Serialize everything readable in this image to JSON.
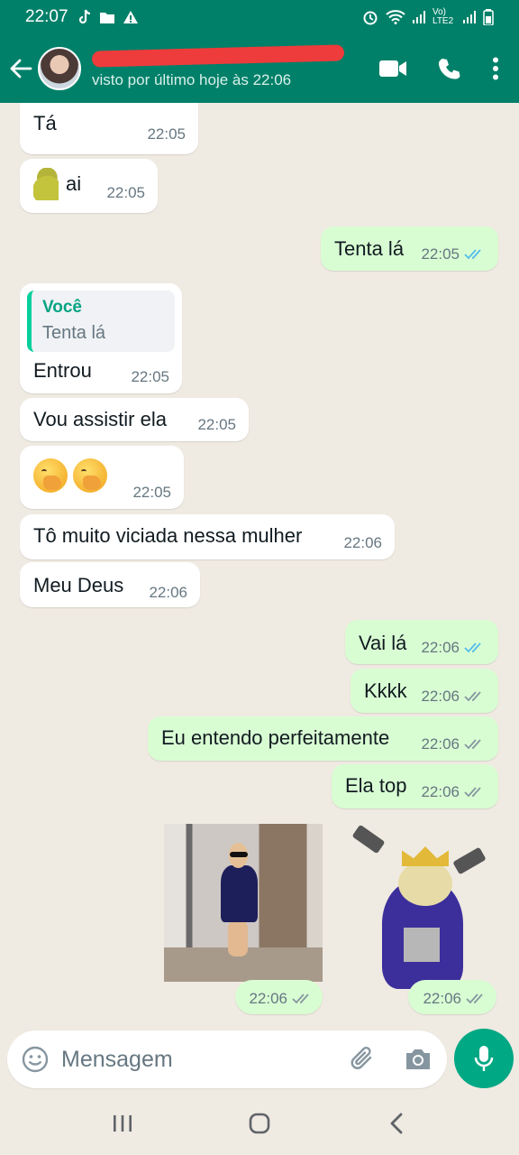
{
  "status_bar": {
    "time": "22:07",
    "network": "Vo) LTE2"
  },
  "header": {
    "contact_status": "visto por último hoje às 22:06"
  },
  "messages": [
    {
      "dir": "in",
      "text": "Tá",
      "time": "22:05"
    },
    {
      "dir": "in",
      "text": "ai",
      "time": "22:05",
      "emoji": "pear"
    },
    {
      "dir": "out",
      "text": "Tenta lá",
      "time": "22:05",
      "ticks": "read"
    },
    {
      "dir": "in",
      "text": "Entrou",
      "time": "22:05",
      "quote_author": "Você",
      "quote_text": "Tenta lá"
    },
    {
      "dir": "in",
      "text": "Vou assistir ela",
      "time": "22:05"
    },
    {
      "dir": "in",
      "text": "",
      "time": "22:05",
      "emoji": "hand-over-mouth x2"
    },
    {
      "dir": "in",
      "text": "Tô muito viciada nessa mulher",
      "time": "22:06"
    },
    {
      "dir": "in",
      "text": "Meu Deus",
      "time": "22:06"
    },
    {
      "dir": "out",
      "text": "Vai lá",
      "time": "22:06",
      "ticks": "read"
    },
    {
      "dir": "out",
      "text": "Kkkk",
      "time": "22:06",
      "ticks": "delivered"
    },
    {
      "dir": "out",
      "text": "Eu entendo perfeitamente",
      "time": "22:06",
      "ticks": "delivered"
    },
    {
      "dir": "out",
      "text": "Ela top",
      "time": "22:06",
      "ticks": "delivered"
    },
    {
      "dir": "out",
      "type": "gif",
      "time": "22:06",
      "ticks": "delivered"
    },
    {
      "dir": "out",
      "type": "sticker",
      "time": "22:06",
      "ticks": "delivered"
    }
  ],
  "composer": {
    "placeholder": "Mensagem"
  },
  "colors": {
    "header": "#008069",
    "outgoing": "#d9fdd3",
    "incoming": "#ffffff",
    "accent": "#00a884",
    "read_tick": "#53bdeb",
    "background": "#efeae2"
  },
  "icons": [
    "back-arrow-icon",
    "video-call-icon",
    "phone-icon",
    "more-options-icon",
    "emoji-icon",
    "attach-icon",
    "camera-icon",
    "mic-icon"
  ]
}
